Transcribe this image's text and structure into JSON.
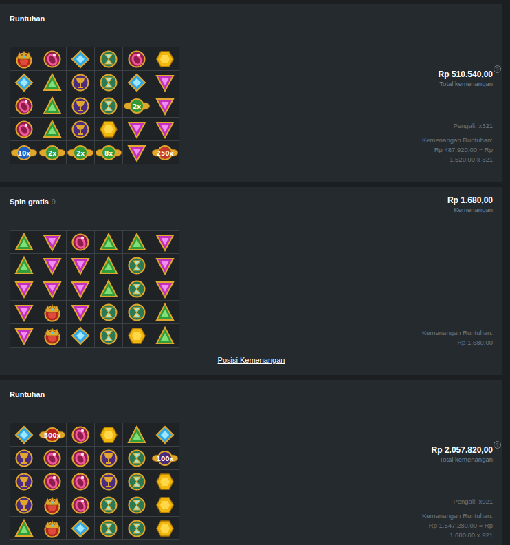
{
  "rounds": [
    {
      "kind": "cascade",
      "title": "Runtuhan",
      "amount": "Rp 510.540,00",
      "help": "?",
      "amount_label": "Total kemenangan",
      "multiplier_text": "Pengali: x321",
      "win_lines": [
        "Kemenangan Runtuhan:",
        "Rp 487.920,00 = Rp",
        "1.520,00 x 321"
      ],
      "grid": [
        [
          {
            "kind": "crown"
          },
          {
            "kind": "ring"
          },
          {
            "kind": "blue"
          },
          {
            "kind": "hourglass"
          },
          {
            "kind": "ring"
          },
          {
            "kind": "yellow"
          }
        ],
        [
          {
            "kind": "blue"
          },
          {
            "kind": "green"
          },
          {
            "kind": "chalice"
          },
          {
            "kind": "hourglass"
          },
          {
            "kind": "blue"
          },
          {
            "kind": "pink"
          }
        ],
        [
          {
            "kind": "ring"
          },
          {
            "kind": "green"
          },
          {
            "kind": "chalice"
          },
          {
            "kind": "hourglass"
          },
          {
            "kind": "multiplier",
            "label": "2x",
            "color": "#2f9a3a"
          },
          {
            "kind": "pink"
          }
        ],
        [
          {
            "kind": "ring"
          },
          {
            "kind": "green"
          },
          {
            "kind": "chalice"
          },
          {
            "kind": "yellow"
          },
          {
            "kind": "pink"
          },
          {
            "kind": "pink"
          }
        ],
        [
          {
            "kind": "multiplier",
            "label": "10x",
            "color": "#1f5fc4"
          },
          {
            "kind": "multiplier",
            "label": "2x",
            "color": "#2f9a3a"
          },
          {
            "kind": "multiplier",
            "label": "2x",
            "color": "#2f9a3a"
          },
          {
            "kind": "multiplier",
            "label": "8x",
            "color": "#2f9a3a"
          },
          {
            "kind": "pink"
          },
          {
            "kind": "multiplier",
            "label": "250x",
            "color": "#c0392b"
          }
        ]
      ]
    },
    {
      "kind": "spin",
      "title": "Spin gratis",
      "count": "9",
      "amount": "Rp 1.680,00",
      "amount_label": "Kemenangan",
      "win_lines": [
        "Kemenangan Runtuhan:",
        "Rp 1.680,00"
      ],
      "link": "Posisi Kemenangan",
      "grid": [
        [
          {
            "kind": "green"
          },
          {
            "kind": "pink"
          },
          {
            "kind": "ring"
          },
          {
            "kind": "green"
          },
          {
            "kind": "green"
          },
          {
            "kind": "pink"
          }
        ],
        [
          {
            "kind": "green"
          },
          {
            "kind": "pink"
          },
          {
            "kind": "pink"
          },
          {
            "kind": "green"
          },
          {
            "kind": "hourglass"
          },
          {
            "kind": "pink"
          }
        ],
        [
          {
            "kind": "pink"
          },
          {
            "kind": "pink"
          },
          {
            "kind": "pink"
          },
          {
            "kind": "green"
          },
          {
            "kind": "hourglass"
          },
          {
            "kind": "pink"
          }
        ],
        [
          {
            "kind": "pink"
          },
          {
            "kind": "crown"
          },
          {
            "kind": "pink"
          },
          {
            "kind": "hourglass"
          },
          {
            "kind": "hourglass"
          },
          {
            "kind": "green"
          }
        ],
        [
          {
            "kind": "pink"
          },
          {
            "kind": "crown"
          },
          {
            "kind": "blue"
          },
          {
            "kind": "hourglass"
          },
          {
            "kind": "yellow"
          },
          {
            "kind": "green"
          }
        ]
      ]
    },
    {
      "kind": "cascade",
      "title": "Runtuhan",
      "amount": "Rp 2.057.820,00",
      "help": "?",
      "amount_label": "Total kemenangan",
      "multiplier_text": "Pengali: x921",
      "win_lines": [
        "Kemenangan Runtuhan:",
        "Rp 1.547.280,00 = Rp",
        "1.680,00 x 921"
      ],
      "grid": [
        [
          {
            "kind": "blue"
          },
          {
            "kind": "multiplier",
            "label": "500x",
            "color": "#b8231c"
          },
          {
            "kind": "ring"
          },
          {
            "kind": "yellow"
          },
          {
            "kind": "green"
          },
          {
            "kind": "blue"
          }
        ],
        [
          {
            "kind": "chalice"
          },
          {
            "kind": "ring"
          },
          {
            "kind": "ring"
          },
          {
            "kind": "chalice"
          },
          {
            "kind": "hourglass"
          },
          {
            "kind": "multiplier",
            "label": "100x",
            "color": "#4a2a7a"
          }
        ],
        [
          {
            "kind": "chalice"
          },
          {
            "kind": "ring"
          },
          {
            "kind": "ring"
          },
          {
            "kind": "chalice"
          },
          {
            "kind": "hourglass"
          },
          {
            "kind": "yellow"
          }
        ],
        [
          {
            "kind": "chalice"
          },
          {
            "kind": "crown"
          },
          {
            "kind": "ring"
          },
          {
            "kind": "hourglass"
          },
          {
            "kind": "hourglass"
          },
          {
            "kind": "yellow"
          }
        ],
        [
          {
            "kind": "green"
          },
          {
            "kind": "crown"
          },
          {
            "kind": "blue"
          },
          {
            "kind": "hourglass"
          },
          {
            "kind": "hourglass"
          },
          {
            "kind": "yellow"
          }
        ]
      ]
    }
  ]
}
